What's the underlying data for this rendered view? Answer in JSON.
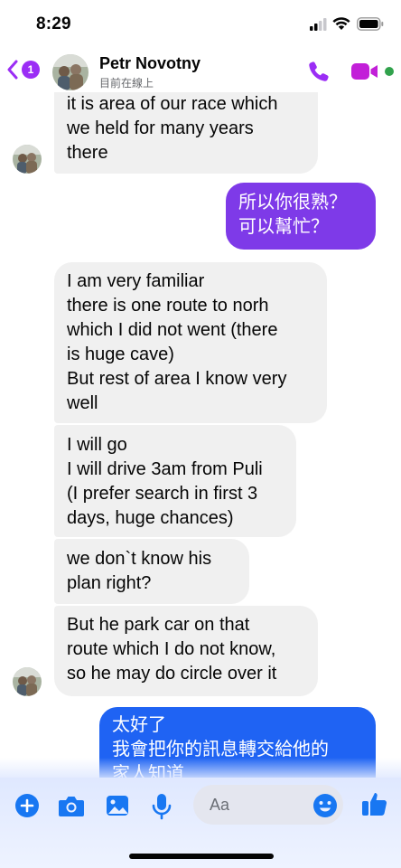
{
  "status_bar": {
    "time": "8:29"
  },
  "header": {
    "back_badge": "1",
    "name": "Petr Novotny",
    "status": "目前在線上"
  },
  "messages": [
    {
      "side": "in",
      "text": "it is area of our race which\nwe held for many years\nthere"
    },
    {
      "side": "out",
      "text": "所以你很熟？\n可以幫忙？"
    },
    {
      "side": "in",
      "text": "I am very familiar\nthere is one route to norh\nwhich I did not went (there\nis huge cave)\nBut rest of area I know very\nwell"
    },
    {
      "side": "in",
      "text": "I will go\nI will drive 3am from Puli\n(I prefer search in first 3\ndays, huge chances)"
    },
    {
      "side": "in",
      "text": "we don`t know his\nplan right?"
    },
    {
      "side": "in",
      "text": "But he park car on that\nroute which I do not know,\nso he may do circle over it"
    },
    {
      "side": "out",
      "text": "太好了\n我會把你的訊息轉交給他的\n家人知道"
    }
  ],
  "composer": {
    "placeholder": "Aa",
    "icons": [
      "plus-icon",
      "camera-icon",
      "gallery-icon",
      "microphone-icon",
      "emoji-icon",
      "thumbs-up-icon"
    ]
  },
  "colors": {
    "accent_purple": "#9b2df5",
    "outgoing_purple": "#7e3ae8",
    "outgoing_blue": "#1f63f3",
    "incoming_gray": "#f0f0f0",
    "composer_icon_blue": "#1877f2",
    "online_green": "#31a24c"
  }
}
